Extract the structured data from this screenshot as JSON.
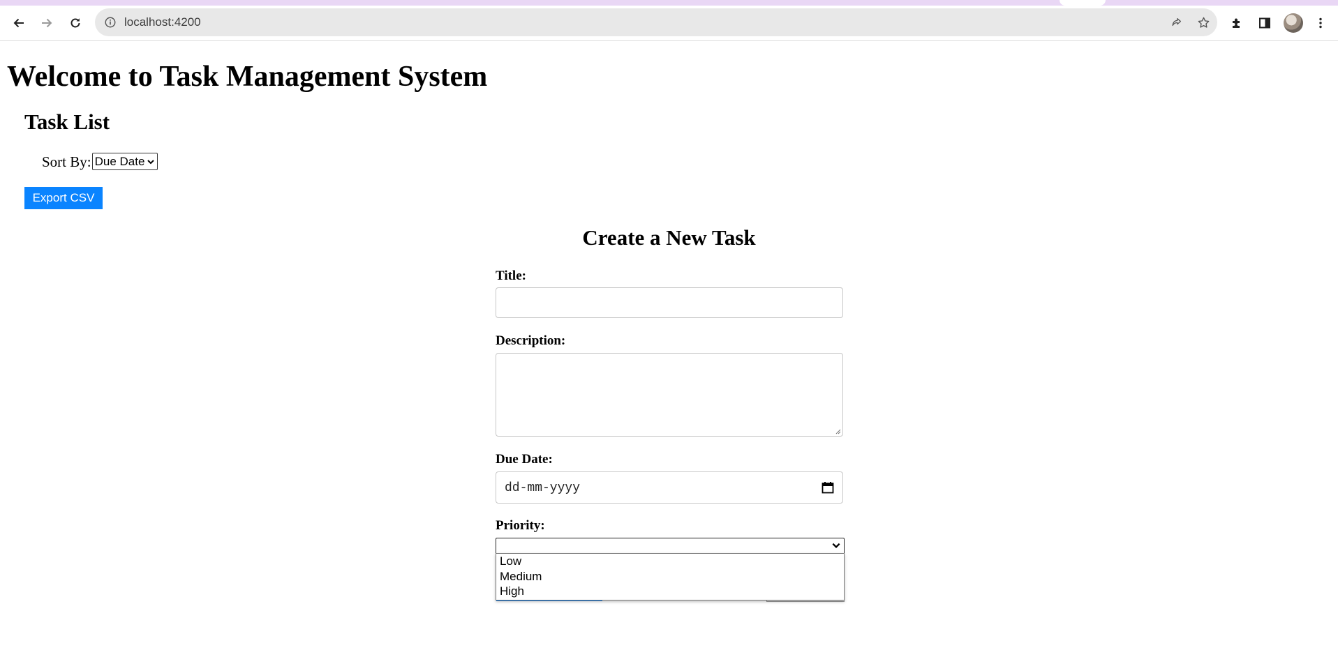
{
  "browser": {
    "url": "localhost:4200",
    "icons": {
      "back": "back-arrow-icon",
      "forward": "forward-arrow-icon",
      "reload": "reload-icon",
      "info": "info-icon",
      "share": "share-icon",
      "bookmark": "star-icon",
      "extensions": "puzzle-icon",
      "sidepanel": "side-panel-icon",
      "profile": "avatar",
      "menu": "kebab-menu-icon"
    },
    "tab_strip_color": "#e9d7f5"
  },
  "page": {
    "title": "Welcome to Task Management System"
  },
  "task_list": {
    "heading": "Task List",
    "sort_label": "Sort By:",
    "sort_value": "Due Date",
    "export_label": "Export CSV",
    "export_color": "#0a84ff"
  },
  "form": {
    "heading": "Create a New Task",
    "title_label": "Title:",
    "title_value": "",
    "description_label": "Description:",
    "description_value": "",
    "due_date_label": "Due Date:",
    "due_date_placeholder": "dd-mm-yyyy",
    "priority_label": "Priority:",
    "priority_value": "",
    "priority_options": [
      "Low",
      "Medium",
      "High"
    ]
  }
}
